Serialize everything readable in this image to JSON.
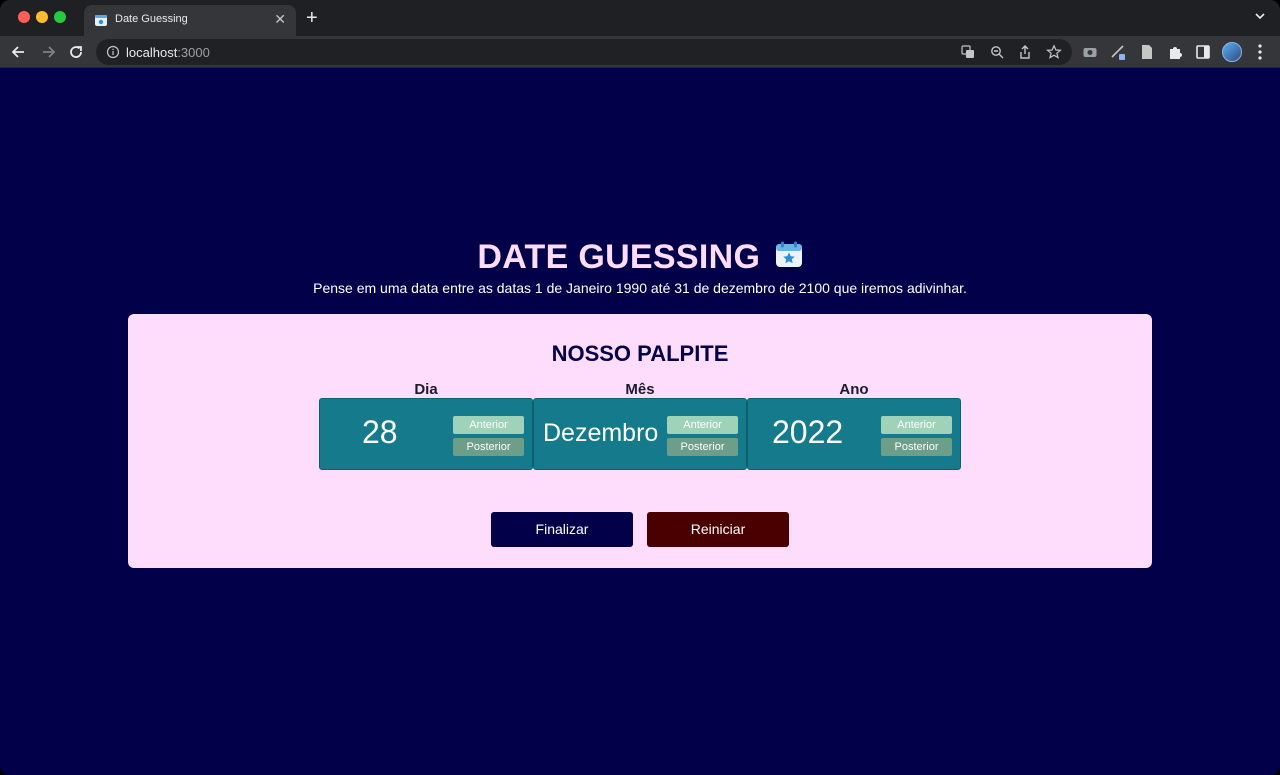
{
  "browser": {
    "tab_title": "Date Guessing",
    "url_host": "localhost",
    "url_port": ":3000"
  },
  "app": {
    "title": "DATE GUESSING",
    "subtitle": "Pense em uma data entre as datas 1 de Janeiro 1990 até 31 de dezembro de 2100 que iremos adivinhar.",
    "card_heading": "NOSSO PALPITE",
    "fields": [
      {
        "label": "Dia",
        "value": "28",
        "prev_label": "Anterior",
        "next_label": "Posterior"
      },
      {
        "label": "Mês",
        "value": "Dezembro",
        "prev_label": "Anterior",
        "next_label": "Posterior"
      },
      {
        "label": "Ano",
        "value": "2022",
        "prev_label": "Anterior",
        "next_label": "Posterior"
      }
    ],
    "finish_label": "Finalizar",
    "restart_label": "Reiniciar"
  },
  "colors": {
    "page_background": "#03004a",
    "card_background": "#fddcfc",
    "field_background": "#147a8c",
    "prev_button": "#9ed3b9",
    "next_button": "#6c9e88",
    "finish_button": "#03004a",
    "restart_button": "#4a0000"
  },
  "icons": {
    "calendar": "calendar-star-icon"
  }
}
